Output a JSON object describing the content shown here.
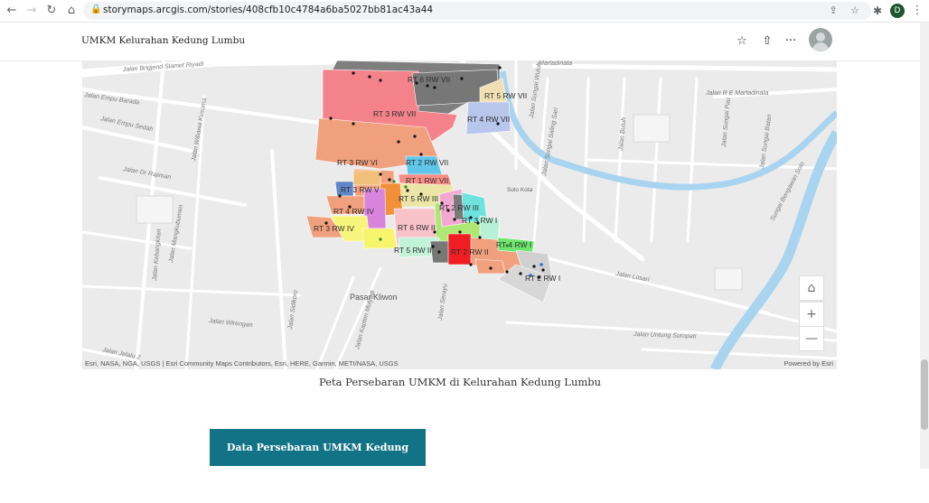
{
  "browser": {
    "url": "storymaps.arcgis.com/stories/408cfb10c4784a6ba5027bb81ac43a44",
    "profile_initial": "D"
  },
  "header": {
    "title": "UMKM Kelurahan Kedung Lumbu"
  },
  "map": {
    "attribution": "Esri, NASA, NGA, USGS | Esri Community Maps Contributors, Esri, HERE, Garmin, METI/NASA, USGS",
    "powered_by": "Powered by Esri",
    "place_label": "Pasar Kliwon",
    "poi_label": "Solo Kota",
    "street_labels": [
      "Jalan Brigjend Slamet Riyadi",
      "Jalan Empu Barada",
      "Jalan Empu Sedah",
      "Jalan Wibawa Kusuma",
      "Jalan Dr Rajiman",
      "Jalan Mangkubumen",
      "Jalan Kebangkitan",
      "Jalan Sidikoro",
      "Jalan Wirengan",
      "Jalan Jelalu 2",
      "Jalan Serayu",
      "Jalan Kapten Mulyadi",
      "Jalan Sungai Wuluh",
      "Jalan Sungai Saling Sari",
      "Jalan Butuh",
      "Jalan Sungai Pau",
      "Jalan Sungai Batan",
      "Jalan R E Martadinata",
      "Jalan Losari",
      "Jalan Untung Suropati",
      "Sungai Bengawan Solo",
      "Martadinata"
    ],
    "areas": [
      "RT 6 RW VII",
      "RT 5 RW VII",
      "RT 3 RW VII",
      "RT 4 RW VII",
      "RT 3 RW VI",
      "RT 2 RW VII",
      "RT 1 RW VII",
      "RT 3 RW V",
      "RT 5 RW III",
      "RT 4 RW IV",
      "RT 3 RW II",
      "RT 2 RW III",
      "RT 3 RW I",
      "RT 3 RW IV",
      "RT 6 RW II",
      "RT 5 RW II",
      "RT 2 RW II",
      "RT 4 RW I",
      "RT 2 RW I"
    ]
  },
  "map_controls": {
    "home_icon": "home-icon",
    "zoom_in": "+",
    "zoom_out": "—"
  },
  "caption": "Peta Persebaran UMKM di Kelurahan Kedung Lumbu",
  "cta_label": "Data Persebaran UMKM Kedung Lumbu",
  "colors": {
    "accent": "#137386",
    "river": "#a8d4f0"
  }
}
